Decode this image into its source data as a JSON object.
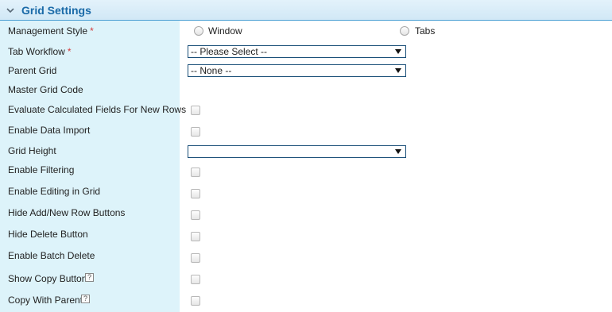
{
  "section": {
    "title": "Grid Settings",
    "collapse_icon": "chevron-down-icon"
  },
  "required_marker": "*",
  "help_glyph": "?",
  "rows": {
    "management_style": {
      "label": "Management Style",
      "required": true,
      "options": [
        {
          "label": "Window",
          "selected": false
        },
        {
          "label": "Tabs",
          "selected": false
        }
      ]
    },
    "tab_workflow": {
      "label": "Tab Workflow",
      "required": true,
      "value": "-- Please Select --"
    },
    "parent_grid": {
      "label": "Parent Grid",
      "value": "-- None --"
    },
    "master_grid_code": {
      "label": "Master Grid Code"
    },
    "evaluate_calculated": {
      "label": "Evaluate Calculated Fields For New Rows",
      "checked": false
    },
    "enable_data_import": {
      "label": "Enable Data Import",
      "checked": false
    },
    "grid_height": {
      "label": "Grid Height",
      "value": ""
    },
    "enable_filtering": {
      "label": "Enable Filtering",
      "checked": false
    },
    "enable_editing": {
      "label": "Enable Editing in Grid",
      "checked": false
    },
    "hide_add_new": {
      "label": "Hide Add/New Row Buttons",
      "checked": false
    },
    "hide_delete": {
      "label": "Hide Delete Button",
      "checked": false
    },
    "enable_batch_delete": {
      "label": "Enable Batch Delete",
      "checked": false
    },
    "show_copy_button": {
      "label": "Show Copy Button",
      "checked": false,
      "help": true
    },
    "copy_with_parent": {
      "label": "Copy With Parent",
      "checked": false,
      "help": true
    }
  },
  "colors": {
    "header_text": "#1a6aa8",
    "label_bg": "#ddf3fa",
    "required": "#d43b3b",
    "select_border": "#1a4f78"
  }
}
